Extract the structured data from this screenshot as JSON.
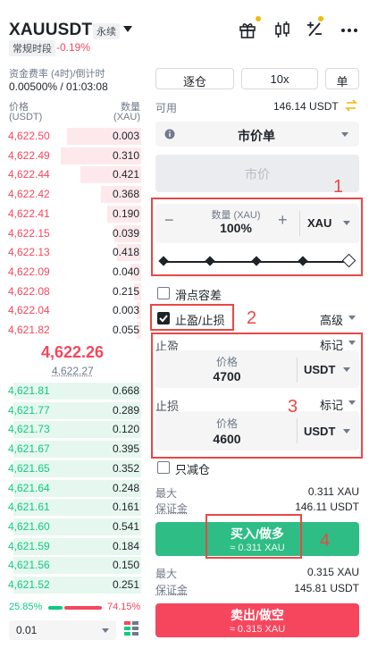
{
  "header": {
    "symbol": "XAUUSDT",
    "contract_tag": "永续",
    "session_tag": "常规时段",
    "change": "-0.19%",
    "icons": [
      "gift-icon",
      "candlestick-icon",
      "plus-minus-icon",
      "more-icon"
    ]
  },
  "funding": {
    "label": "资金费率 (4时)/倒计时",
    "value": "0.00500% / 01:03:08"
  },
  "orderbook": {
    "price_header": "价格",
    "price_unit": "(USDT)",
    "qty_header": "数量",
    "qty_unit": "(XAU)",
    "asks": [
      {
        "price": "4,622.50",
        "qty": "0.003",
        "depth": 0.55
      },
      {
        "price": "4,622.49",
        "qty": "0.310",
        "depth": 0.6
      },
      {
        "price": "4,622.44",
        "qty": "0.421",
        "depth": 0.45
      },
      {
        "price": "4,622.42",
        "qty": "0.368",
        "depth": 0.3
      },
      {
        "price": "4,622.41",
        "qty": "0.190",
        "depth": 0.25
      },
      {
        "price": "4,622.15",
        "qty": "0.039",
        "depth": 0.2
      },
      {
        "price": "4,622.13",
        "qty": "0.418",
        "depth": 0.18
      },
      {
        "price": "4,622.09",
        "qty": "0.040",
        "depth": 0.08
      },
      {
        "price": "4,622.08",
        "qty": "0.215",
        "depth": 0.05
      },
      {
        "price": "4,622.04",
        "qty": "0.003",
        "depth": 0.03
      },
      {
        "price": "4,621.82",
        "qty": "0.055",
        "depth": 0.03
      }
    ],
    "mid_price": "4,622.26",
    "mark_price": "4,622.27",
    "bids": [
      {
        "price": "4,621.81",
        "qty": "0.668",
        "depth": 0.95
      },
      {
        "price": "4,621.77",
        "qty": "0.289",
        "depth": 0.95
      },
      {
        "price": "4,621.73",
        "qty": "0.120",
        "depth": 0.95
      },
      {
        "price": "4,621.67",
        "qty": "0.395",
        "depth": 0.95
      },
      {
        "price": "4,621.65",
        "qty": "0.352",
        "depth": 0.95
      },
      {
        "price": "4,621.64",
        "qty": "0.248",
        "depth": 0.95
      },
      {
        "price": "4,621.61",
        "qty": "0.161",
        "depth": 0.95
      },
      {
        "price": "4,621.60",
        "qty": "0.541",
        "depth": 0.95
      },
      {
        "price": "4,621.59",
        "qty": "0.184",
        "depth": 0.95
      },
      {
        "price": "4,621.56",
        "qty": "0.150",
        "depth": 0.95
      },
      {
        "price": "4,621.52",
        "qty": "0.251",
        "depth": 0.95
      }
    ],
    "buy_ratio": "25.85%",
    "sell_ratio": "74.15%",
    "buy_ratio_value": 0.2585,
    "depth_precision": "0.01"
  },
  "order_form": {
    "margin_mode": "逐仓",
    "leverage": "10x",
    "position_mode": "单",
    "available_label": "可用",
    "available_value": "146.14 USDT",
    "order_type": "市价单",
    "price_placeholder": "市价",
    "qty_label": "数量 (XAU)",
    "qty_value": "100%",
    "qty_unit": "XAU",
    "slippage_label": "滑点容差",
    "tpsl_label": "止盈/止损",
    "tpsl_checked": true,
    "advanced_label": "高级",
    "tp_label": "止盈",
    "tp_trigger": "标记",
    "tp_price_label": "价格",
    "tp_price": "4700",
    "tp_unit": "USDT",
    "sl_label": "止损",
    "sl_trigger": "标记",
    "sl_price_label": "价格",
    "sl_price": "4600",
    "sl_unit": "USDT",
    "reduce_only_label": "只减仓",
    "buy_max_label": "最大",
    "buy_max_value": "0.311 XAU",
    "buy_margin_label": "保证金",
    "buy_margin_value": "146.11 USDT",
    "buy_label": "买入/做多",
    "buy_sub": "≈ 0.311 XAU",
    "sell_max_label": "最大",
    "sell_max_value": "0.315 XAU",
    "sell_margin_label": "保证金",
    "sell_margin_value": "145.81 USDT",
    "sell_label": "卖出/做空",
    "sell_sub": "≈ 0.315 XAU"
  },
  "annotations": {
    "box1": "1",
    "box2": "2",
    "box3": "3",
    "box4": "4",
    "color": "#e84848"
  },
  "colors": {
    "up": "#0ecb81",
    "down": "#f6465d",
    "accent": "#f0b90b"
  }
}
